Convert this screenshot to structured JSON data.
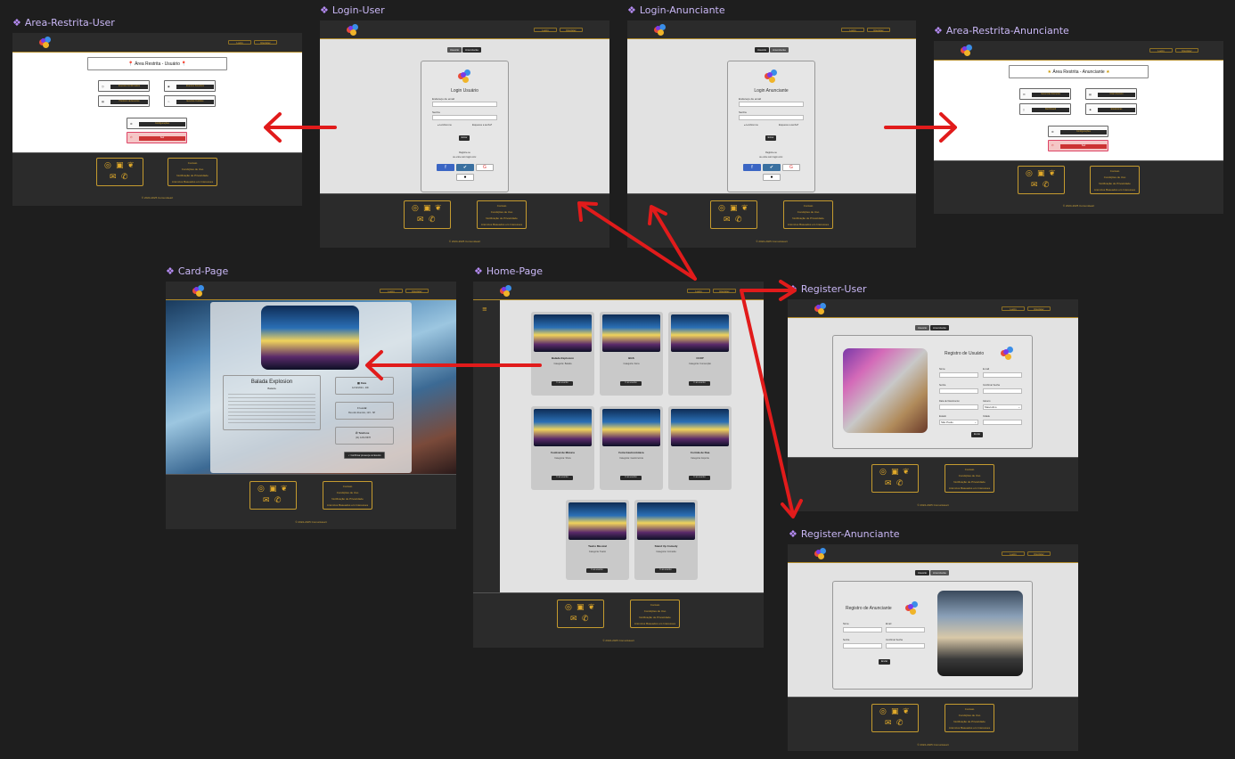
{
  "frames": {
    "area_user": "Area-Restrita-User",
    "login_user": "Login-User",
    "login_anunciante": "Login-Anunciante",
    "area_anunciante": "Area-Restrita-Anunciante",
    "card_page": "Card-Page",
    "home_page": "Home-Page",
    "register_user": "Register-User",
    "register_anunciante": "Register-Anunciante"
  },
  "nav": {
    "login": "Login",
    "register": "Register"
  },
  "footer": {
    "links": [
      "Contato",
      "Condições de Uso",
      "Notificação de Privacidade",
      "Anúncios Baseados em Interesses"
    ],
    "copyright": "© 2024-2025 ComunHeart"
  },
  "area_user": {
    "title": "Área Restrita - Usuário",
    "options": [
      "Eventos Confirmados",
      "Eventos Favoritos",
      "Histórico de Eventos",
      "Eventos Curtidos",
      "Configurações",
      "Sair"
    ]
  },
  "area_anunciante": {
    "title": "Área Restrita - Anunciante",
    "options": [
      "Gerenciar Anúncios",
      "Criar Anúncio",
      "Dashboard",
      "Estatísticas",
      "Configurações",
      "Sair"
    ]
  },
  "login_user": {
    "tabs": [
      "Usuário",
      "Anunciante"
    ],
    "title": "Login Usuário",
    "email_label": "Endereço de email",
    "password_label": "Senha",
    "remember": "Lembrar-me",
    "forgot": "Esqueceu a senha?",
    "submit": "Entrar",
    "register_prompt": "Registre-se",
    "alt": "ou entre com login com:"
  },
  "login_anunciante": {
    "tabs": [
      "Usuário",
      "Anunciante"
    ],
    "title": "Login Anunciante",
    "email_label": "Endereço de email",
    "password_label": "Senha",
    "remember": "Lembrar-me",
    "forgot": "Esqueceu a senha?",
    "submit": "Entrar",
    "register_prompt": "Registre-se",
    "alt": "ou entre com login com:"
  },
  "card_page": {
    "title": "Balada Explosion",
    "subtitle": "Balada",
    "info": [
      {
        "label": "Data",
        "value": "12/12/2024 - 20h"
      },
      {
        "label": "Local",
        "value": "Rua dos Eventos, 123 - SP"
      },
      {
        "label": "Telefone",
        "value": "(11) 1234-5678"
      }
    ],
    "cta": "Confirmar presença no Evento"
  },
  "home_page": {
    "cards": [
      {
        "title": "Balada Explosion",
        "sub": "Categoria: Balada",
        "btn": "Ir ao evento"
      },
      {
        "title": "BGS",
        "sub": "Categoria: Feira",
        "btn": "Ir ao evento"
      },
      {
        "title": "CCXP",
        "sub": "Categoria: Convenção",
        "btn": "Ir ao evento"
      },
      {
        "title": "Festival de Música",
        "sub": "Categoria: Show",
        "btn": "Ir ao evento"
      },
      {
        "title": "Feira Gastronômica",
        "sub": "Categoria: Gastronomia",
        "btn": "Ir ao evento"
      },
      {
        "title": "Corrida de Rua",
        "sub": "Categoria: Esporte",
        "btn": "Ir ao evento"
      },
      {
        "title": "Teatro Musical",
        "sub": "Categoria: Teatro",
        "btn": "Ir ao evento"
      },
      {
        "title": "Stand Up Comedy",
        "sub": "Categoria: Comédia",
        "btn": "Ir ao evento"
      }
    ]
  },
  "register_user": {
    "tabs": [
      "Usuário",
      "Anunciante"
    ],
    "title": "Registro de Usuário",
    "fields": [
      "Nome",
      "E-mail",
      "Senha",
      "Confirmar Senha",
      "Data de Nascimento",
      "Gênero",
      "Estado",
      "Cidade"
    ],
    "genero_value": "Masculino",
    "estado_value": "São Paulo",
    "submit": "Enviar"
  },
  "register_anunciante": {
    "tabs": [
      "Usuário",
      "Anunciante"
    ],
    "title": "Registro de Anunciante",
    "fields": [
      "Nome",
      "Email",
      "Senha",
      "Confirmar Senha"
    ],
    "submit": "Enviar"
  },
  "colors": {
    "accent": "#d4a531",
    "arrow": "#e11b1b",
    "frame_label": "#c9b7f5"
  }
}
